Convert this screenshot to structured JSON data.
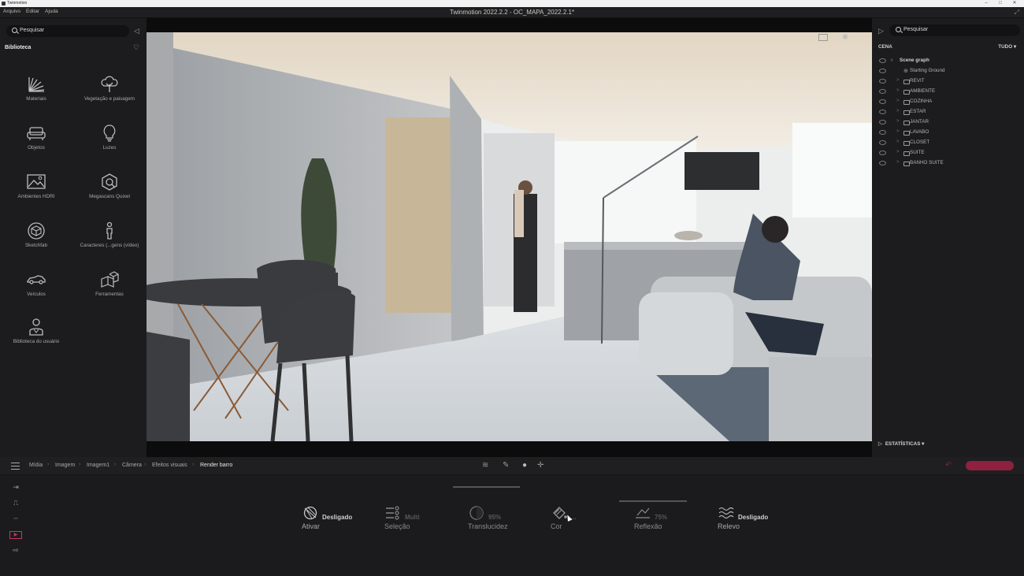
{
  "os": {
    "app_name": "Twinmotion",
    "min": "–",
    "max": "□",
    "close": "✕"
  },
  "menu": {
    "items": [
      "Arquivo",
      "Editar",
      "Ajuda"
    ]
  },
  "window_title": "Twinmotion 2022.2.2 - OC_MAPA_2022.2.1*",
  "library": {
    "search_placeholder": "Pesquisar",
    "title": "Biblioteca",
    "items": [
      {
        "label": "Materiais",
        "icon": "materials-icon"
      },
      {
        "label": "Vegetação e paisagem",
        "icon": "tree-icon"
      },
      {
        "label": "Objetos",
        "icon": "sofa-icon"
      },
      {
        "label": "Luzes",
        "icon": "lightbulb-icon"
      },
      {
        "label": "Ambientes HDRI",
        "icon": "hdri-image-icon"
      },
      {
        "label": "Megascans Quixel",
        "icon": "megascans-icon"
      },
      {
        "label": "Sketchfab",
        "icon": "sketchfab-icon"
      },
      {
        "label": "Caracteres (...gens (vídeo)",
        "icon": "character-icon"
      },
      {
        "label": "Veículos",
        "icon": "car-icon"
      },
      {
        "label": "Ferramentas",
        "icon": "boxes-icon"
      },
      {
        "label": "Biblioteca do usuário",
        "icon": "user-library-icon"
      }
    ]
  },
  "scene": {
    "search_placeholder": "Pesquisar",
    "title": "CENA",
    "filter": "TUDO ▾",
    "graph_root": "Scene graph",
    "items": [
      "Starting Ground",
      "REVIT",
      "AMBIENTE",
      "COZINHA",
      "ESTAR",
      "JANTAR",
      "LAVABO",
      "CLOSET",
      "SUITE",
      "BANHO SUITE"
    ],
    "stats_label": "ESTATÍSTICAS ▾"
  },
  "breadcrumb": [
    "Mídia",
    "Imagem",
    "Imagem1",
    "Câmera",
    "Efeitos visuais",
    "Render barro"
  ],
  "properties": {
    "ativar": {
      "value": "Desligado",
      "label": "Ativar"
    },
    "selecao": {
      "value": "Multi",
      "label": "Seleção"
    },
    "translucidez": {
      "value": "95%",
      "label": "Translucidez"
    },
    "cor": {
      "value": "...",
      "label": "Cor"
    },
    "reflexao": {
      "value": "75%",
      "label": "Reflexão"
    },
    "relevo": {
      "value": "Desligado",
      "label": "Relevo"
    }
  },
  "colors": {
    "accent": "#8e2140",
    "panel": "#1c1c1e",
    "background": "#1b1b1d"
  }
}
